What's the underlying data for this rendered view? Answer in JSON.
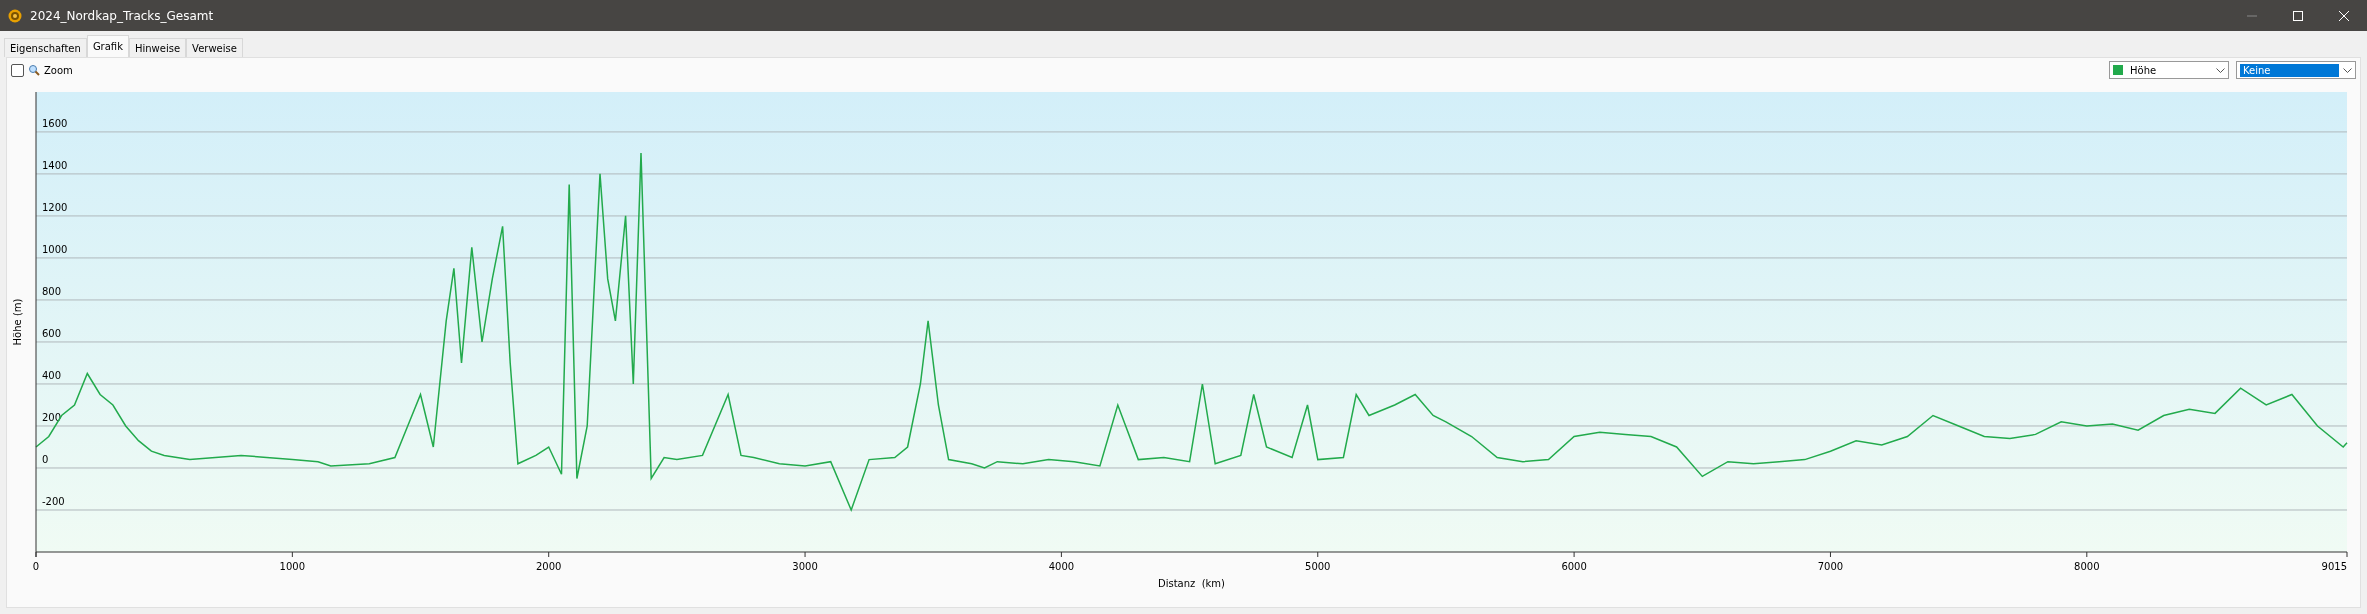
{
  "window": {
    "title": "2024_Nordkap_Tracks_Gesamt"
  },
  "tabs": [
    {
      "label": "Eigenschaften",
      "selected": false
    },
    {
      "label": "Grafik",
      "selected": true
    },
    {
      "label": "Hinweise",
      "selected": false
    },
    {
      "label": "Verweise",
      "selected": false
    }
  ],
  "toolbar": {
    "zoom": {
      "label": "Zoom",
      "checked": false
    },
    "series_select": {
      "open": false
    },
    "compare_select": {
      "value": "Keine",
      "highlighted": true
    }
  },
  "chart": {
    "chart_data": {
      "type": "line",
      "grid": true,
      "xlabel": "Distanz  (km)",
      "ylabel": "Höhe (m)",
      "x": [
        0,
        50,
        100,
        150,
        200,
        250,
        300,
        350,
        400,
        450,
        500,
        600,
        700,
        800,
        900,
        1000,
        1100,
        1150,
        1300,
        1400,
        1450,
        1500,
        1550,
        1600,
        1630,
        1660,
        1700,
        1740,
        1780,
        1820,
        1850,
        1880,
        1950,
        2000,
        2050,
        2080,
        2110,
        2150,
        2200,
        2230,
        2260,
        2300,
        2330,
        2360,
        2400,
        2450,
        2500,
        2600,
        2700,
        2750,
        2800,
        2900,
        3000,
        3100,
        3180,
        3250,
        3350,
        3400,
        3450,
        3480,
        3520,
        3560,
        3650,
        3700,
        3750,
        3850,
        3950,
        4050,
        4150,
        4220,
        4300,
        4400,
        4500,
        4550,
        4600,
        4700,
        4750,
        4800,
        4900,
        4960,
        5000,
        5100,
        5150,
        5200,
        5300,
        5380,
        5450,
        5500,
        5600,
        5700,
        5800,
        5900,
        6000,
        6100,
        6200,
        6300,
        6400,
        6500,
        6600,
        6700,
        6800,
        6900,
        7000,
        7100,
        7200,
        7300,
        7400,
        7500,
        7600,
        7700,
        7800,
        7900,
        8000,
        8100,
        8200,
        8300,
        8400,
        8500,
        8600,
        8700,
        8800,
        8900,
        9000,
        9015
      ],
      "series": [
        {
          "name": "Höhe",
          "color": "#22aa4c",
          "values": [
            100,
            150,
            250,
            300,
            450,
            350,
            300,
            200,
            130,
            80,
            60,
            40,
            50,
            60,
            50,
            40,
            30,
            10,
            20,
            50,
            200,
            350,
            100,
            700,
            950,
            500,
            1050,
            600,
            900,
            1150,
            500,
            20,
            60,
            100,
            -30,
            1350,
            -50,
            200,
            1400,
            900,
            700,
            1200,
            400,
            1500,
            -50,
            50,
            40,
            60,
            350,
            60,
            50,
            20,
            10,
            30,
            -200,
            40,
            50,
            100,
            400,
            700,
            300,
            40,
            20,
            0,
            30,
            20,
            40,
            30,
            10,
            300,
            40,
            50,
            30,
            400,
            20,
            60,
            350,
            100,
            50,
            300,
            40,
            50,
            350,
            250,
            300,
            350,
            250,
            220,
            150,
            50,
            30,
            40,
            150,
            170,
            160,
            150,
            100,
            -40,
            30,
            20,
            30,
            40,
            80,
            130,
            110,
            150,
            250,
            200,
            150,
            140,
            160,
            220,
            200,
            210,
            180,
            250,
            280,
            260,
            380,
            300,
            350,
            200,
            100,
            120
          ]
        }
      ],
      "xlim": [
        0,
        9015
      ],
      "ylim": [
        -400,
        1790
      ],
      "xticks": [
        0,
        1000,
        2000,
        3000,
        4000,
        5000,
        6000,
        7000,
        8000,
        9015
      ],
      "yticks": [
        -200,
        0,
        200,
        400,
        600,
        800,
        1000,
        1200,
        1400,
        1600
      ]
    }
  }
}
